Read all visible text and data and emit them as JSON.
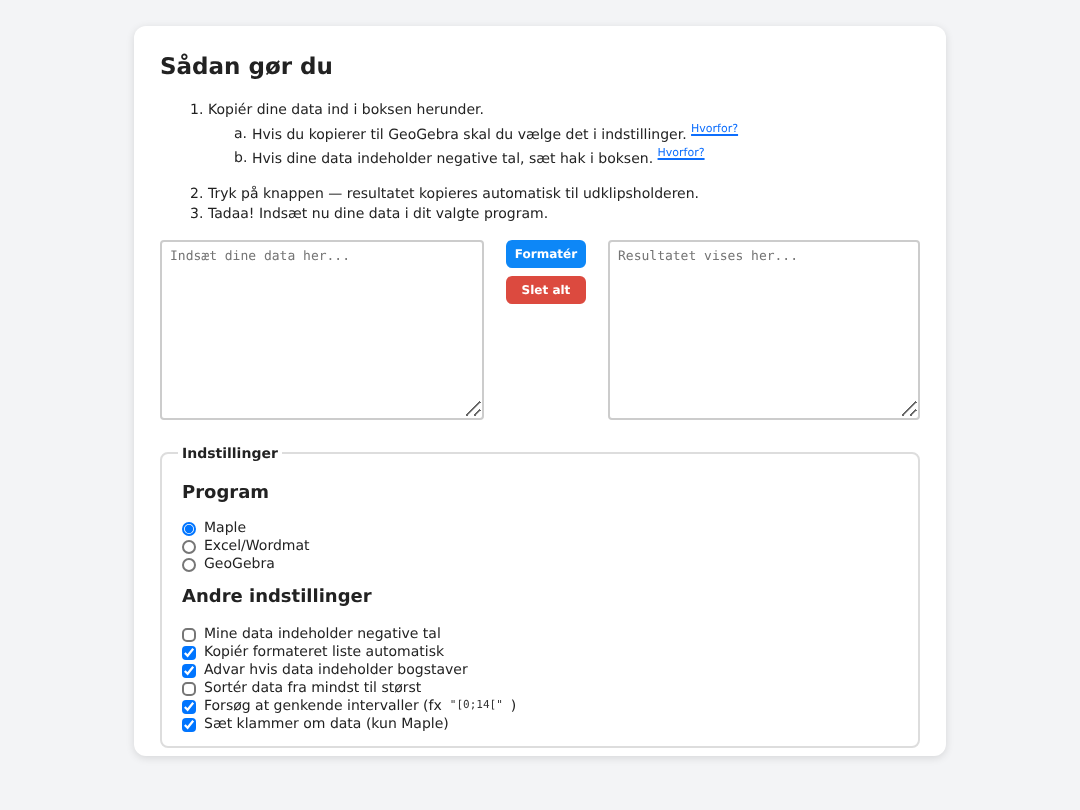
{
  "title": "Sådan gør du",
  "steps": [
    {
      "marker": "1.",
      "text": "Kopiér dine data ind i boksen herunder.",
      "substeps": [
        {
          "marker": "a.",
          "text": "Hvis du kopierer til GeoGebra skal du vælge det i indstillinger.",
          "link": "Hvorfor?"
        },
        {
          "marker": "b.",
          "text": "Hvis dine data indeholder negative tal, sæt hak i boksen.",
          "link": "Hvorfor?"
        }
      ]
    },
    {
      "marker": "2.",
      "text": "Tryk på knappen — resultatet kopieres automatisk til udklipsholderen."
    },
    {
      "marker": "3.",
      "text": "Tadaa! Indsæt nu dine data i dit valgte program."
    }
  ],
  "input": {
    "placeholder": "Indsæt dine data her..."
  },
  "buttons": [
    {
      "label": "Formatér",
      "kind": "primary"
    },
    {
      "label": "Slet alt",
      "kind": "danger"
    }
  ],
  "output": {
    "placeholder": "Resultatet vises her..."
  },
  "settings": {
    "legend": "Indstillinger",
    "program_heading": "Program",
    "programs": [
      {
        "label": "Maple",
        "selected": true
      },
      {
        "label": "Excel/Wordmat",
        "selected": false
      },
      {
        "label": "GeoGebra",
        "selected": false
      }
    ],
    "other_heading": "Andre indstillinger",
    "options": [
      {
        "label": "Mine data indeholder negative tal",
        "checked": false
      },
      {
        "label": "Kopiér formateret liste automatisk",
        "checked": true
      },
      {
        "label": "Advar hvis data indeholder bogstaver",
        "checked": true
      },
      {
        "label": "Sortér data fra mindst til størst",
        "checked": false
      },
      {
        "label": "Forsøg at genkende intervaller (fx",
        "code": "\"[0;14[\"",
        "suffix": ")",
        "checked": true
      },
      {
        "label": "Sæt klammer om data (kun Maple)",
        "checked": true
      }
    ]
  }
}
